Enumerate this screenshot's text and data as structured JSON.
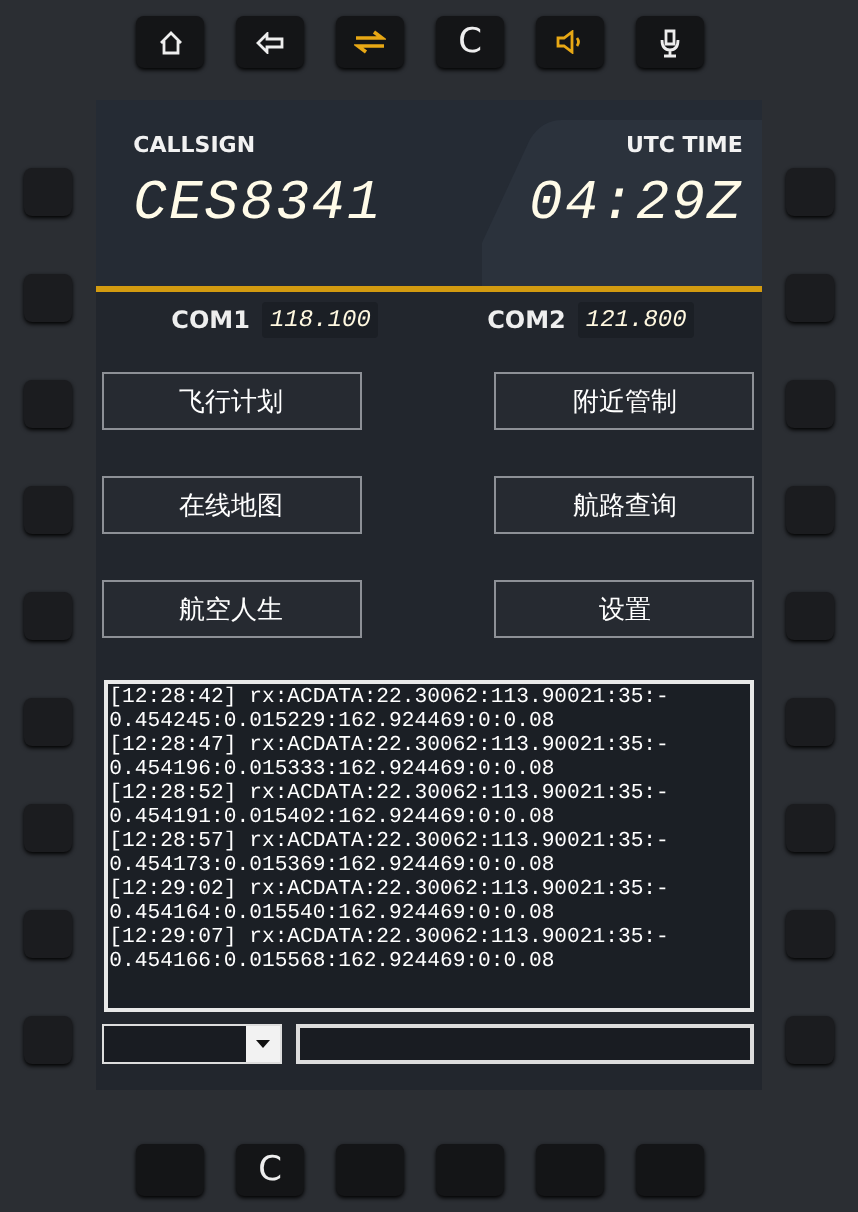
{
  "top_buttons": [
    {
      "kind": "home",
      "on": false
    },
    {
      "kind": "back",
      "on": false
    },
    {
      "kind": "swap",
      "on": true
    },
    {
      "kind": "text",
      "label": "C",
      "on": false
    },
    {
      "kind": "speaker",
      "on": true
    },
    {
      "kind": "mic",
      "on": false
    }
  ],
  "header": {
    "callsign_label": "CALLSIGN",
    "callsign": "CES8341",
    "utc_label": "UTC TIME",
    "utc": "04:29Z"
  },
  "radios": [
    {
      "label": "COM1",
      "frequency": "118.100"
    },
    {
      "label": "COM2",
      "frequency": "121.800"
    }
  ],
  "menu": [
    "飞行计划",
    "附近管制",
    "在线地图",
    "航路查询",
    "航空人生",
    "设置"
  ],
  "log": [
    "[12:28:42] rx:ACDATA:22.30062:113.90021:35:-",
    "0.454245:0.015229:162.924469:0:0.08",
    "[12:28:47] rx:ACDATA:22.30062:113.90021:35:-",
    "0.454196:0.015333:162.924469:0:0.08",
    "[12:28:52] rx:ACDATA:22.30062:113.90021:35:-",
    "0.454191:0.015402:162.924469:0:0.08",
    "[12:28:57] rx:ACDATA:22.30062:113.90021:35:-",
    "0.454173:0.015369:162.924469:0:0.08",
    "[12:29:02] rx:ACDATA:22.30062:113.90021:35:-",
    "0.454164:0.015540:162.924469:0:0.08",
    "[12:29:07] rx:ACDATA:22.30062:113.90021:35:-",
    "0.454166:0.015568:162.924469:0:0.08"
  ],
  "bottom_buttons": [
    {
      "kind": "blank"
    },
    {
      "kind": "text",
      "label": "C"
    },
    {
      "kind": "blank"
    },
    {
      "kind": "blank"
    },
    {
      "kind": "blank"
    },
    {
      "kind": "blank"
    }
  ]
}
